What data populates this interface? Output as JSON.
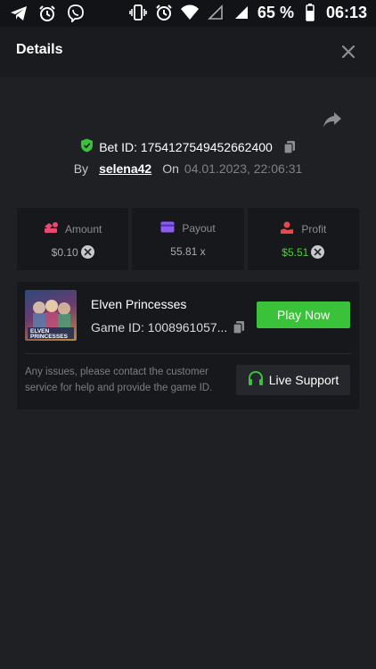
{
  "status_bar": {
    "battery": "65 %",
    "time": "06:13",
    "left_icons": [
      "telegram-icon",
      "alarm-icon",
      "viber-icon"
    ],
    "right_icons": [
      "vibrate-icon",
      "alarm-icon",
      "wifi-icon",
      "signal-empty-icon",
      "signal-icon",
      "battery-icon"
    ]
  },
  "header": {
    "title": "Details"
  },
  "bet": {
    "id_label": "Bet ID: 1754127549452662400",
    "by_label": "By",
    "user": "selena42",
    "on_label": "On",
    "date": "04.01.2023, 22:06:31"
  },
  "stats": {
    "amount": {
      "label": "Amount",
      "value": "$0.10",
      "color": "#e84a6f"
    },
    "payout": {
      "label": "Payout",
      "value": "55.81 x",
      "color": "#8b5cf6"
    },
    "profit": {
      "label": "Profit",
      "value": "$5.51",
      "color": "#e84a4a"
    }
  },
  "game": {
    "name": "Elven Princesses",
    "game_id": "Game ID: 1008961057...",
    "play_label": "Play Now",
    "thumb_text_1": "ELVEN",
    "thumb_text_2": "PRINCESSES"
  },
  "support": {
    "text": "Any issues, please contact the customer service for help and provide the game ID.",
    "button_label": "Live Support"
  },
  "colors": {
    "background": "#1f2024",
    "card": "#17181b",
    "accent_green": "#3ac23a",
    "profit_green": "#4cd137"
  }
}
